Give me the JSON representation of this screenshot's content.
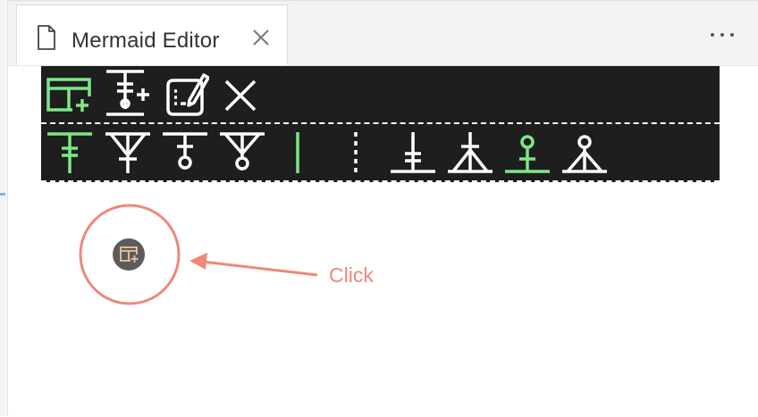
{
  "window": {
    "tab_title": "Mermaid Editor",
    "tab_icon": "file-icon",
    "close_icon": "close-icon",
    "more_icon": "more-actions-icon"
  },
  "toolbar": {
    "row1": [
      {
        "name": "add-entity-button",
        "icon": "table-add-icon",
        "color": "#7ee787"
      },
      {
        "name": "add-attribute-button",
        "icon": "attribute-add-icon",
        "color": "#ffffff"
      },
      {
        "name": "edit-button",
        "icon": "edit-document-icon",
        "color": "#ffffff"
      },
      {
        "name": "delete-button",
        "icon": "close-x-icon",
        "color": "#ffffff"
      }
    ],
    "row2": [
      {
        "name": "exactly-one-left",
        "icon": "exactly-one-icon",
        "color": "#7ee787"
      },
      {
        "name": "one-or-more-left",
        "icon": "one-or-more-icon",
        "color": "#ffffff"
      },
      {
        "name": "zero-or-one-left",
        "icon": "zero-or-one-icon",
        "color": "#ffffff"
      },
      {
        "name": "zero-or-more-left",
        "icon": "zero-or-more-icon",
        "color": "#ffffff"
      },
      {
        "name": "identifying-line",
        "icon": "solid-line-icon",
        "color": "#7ee787"
      },
      {
        "name": "non-identifying-line",
        "icon": "dotted-line-icon",
        "color": "#ffffff"
      },
      {
        "name": "exactly-one-right",
        "icon": "exactly-one-icon",
        "color": "#ffffff"
      },
      {
        "name": "one-or-more-right",
        "icon": "one-or-more-icon",
        "color": "#ffffff"
      },
      {
        "name": "zero-or-one-right",
        "icon": "zero-or-one-icon",
        "color": "#7ee787"
      },
      {
        "name": "zero-or-more-right",
        "icon": "zero-or-more-icon",
        "color": "#ffffff"
      }
    ]
  },
  "annotation": {
    "label": "Click",
    "color": "#ee8879",
    "target_icon": "table-add-icon"
  }
}
